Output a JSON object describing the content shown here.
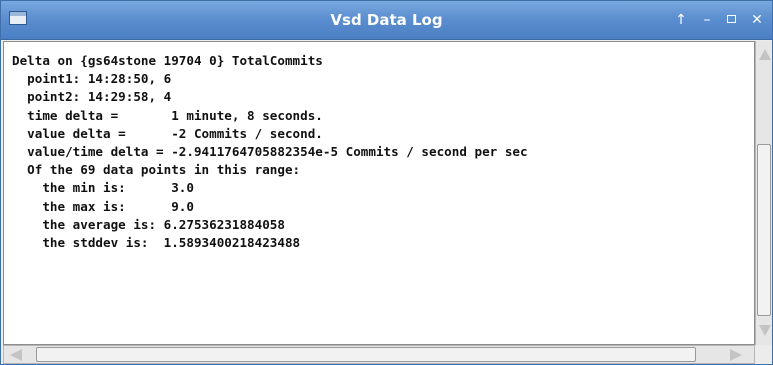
{
  "window": {
    "title": "Vsd Data Log",
    "controls": {
      "up_glyph": "↑",
      "minimize_glyph": "–",
      "close_glyph": "✕"
    }
  },
  "log": {
    "lines": [
      "Delta on {gs64stone 19704 0} TotalCommits",
      "  point1: 14:28:50, 6",
      "  point2: 14:29:58, 4",
      "  time delta =       1 minute, 8 seconds.",
      "  value delta =      -2 Commits / second.",
      "  value/time delta = -2.9411764705882354e-5 Commits / second per sec",
      "  Of the 69 data points in this range:",
      "    the min is:      3.0",
      "    the max is:      9.0",
      "    the average is: 6.27536231884058",
      "    the stddev is:  1.5893400218423488"
    ]
  },
  "scrollbars": {
    "icons": [
      "scroll-up-arrow-icon",
      "scroll-down-arrow-icon",
      "scroll-left-arrow-icon",
      "scroll-right-arrow-icon"
    ]
  }
}
